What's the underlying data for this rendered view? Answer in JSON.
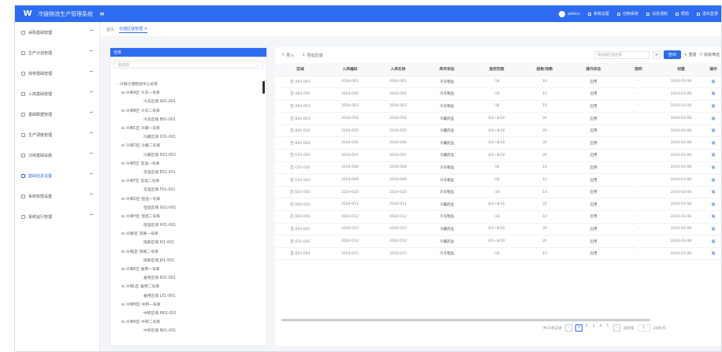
{
  "header": {
    "title": "冷链物流生产管理系统",
    "menu_icon": "menu-fold-icon",
    "user": "admin",
    "items": [
      "系统设置",
      "切换系统",
      "消息通知",
      "帮助",
      "退出登录"
    ]
  },
  "sidebar": {
    "items": [
      {
        "label": "采购基础管理",
        "active": false
      },
      {
        "label": "生产计划管理",
        "active": false
      },
      {
        "label": "库存基础管理",
        "active": false
      },
      {
        "label": "入库基础管理",
        "active": false
      },
      {
        "label": "基础数据管理",
        "active": false
      },
      {
        "label": "生产调度管理",
        "active": false
      },
      {
        "label": "冷库基础设施",
        "active": false
      },
      {
        "label": "基础信息设置",
        "active": true
      },
      {
        "label": "系统权限设置",
        "active": false
      },
      {
        "label": "系统运行管理",
        "active": false
      }
    ]
  },
  "breadcrumb": {
    "home": "首页",
    "tab": "仓储区域管理"
  },
  "tree": {
    "title": "仓库",
    "search_placeholder": "请选择",
    "nodes": [
      {
        "level": 0,
        "label": "– 冷链仓储配送中心总库"
      },
      {
        "level": 1,
        "label": "⊟ 冷库A区 冷冻一号库"
      },
      {
        "level": 2,
        "label": "冷冻区域 A01-001"
      },
      {
        "level": 1,
        "label": "⊟ 冷库B区 冷冻二号库"
      },
      {
        "level": 2,
        "label": "冷冻区域 B01-001"
      },
      {
        "level": 1,
        "label": "⊟ 冷库C区 冷藏一号库"
      },
      {
        "level": 2,
        "label": "冷藏区域 C01-001"
      },
      {
        "level": 1,
        "label": "⊟ 冷库D区 冷藏二号库"
      },
      {
        "level": 2,
        "label": "冷藏区域 D01-001"
      },
      {
        "level": 1,
        "label": "⊟ 冷库E区 常温一号库"
      },
      {
        "level": 2,
        "label": "常温区域 E01-001"
      },
      {
        "level": 1,
        "label": "⊟ 冷库F区 常温二号库"
      },
      {
        "level": 2,
        "label": "常温区域 F01-001"
      },
      {
        "level": 1,
        "label": "⊟ 冷库G区 恒温一号库"
      },
      {
        "level": 2,
        "label": "恒温区域 G01-001"
      },
      {
        "level": 1,
        "label": "⊟ 冷库H区 恒温二号库"
      },
      {
        "level": 2,
        "label": "恒温区域 H01-001"
      },
      {
        "level": 1,
        "label": "⊟ 冷库I区 隔离一号库"
      },
      {
        "level": 2,
        "label": "隔离区域 I01-001"
      },
      {
        "level": 1,
        "label": "⊟ 冷库J区 隔离二号库"
      },
      {
        "level": 2,
        "label": "隔离区域 J01-001"
      },
      {
        "level": 1,
        "label": "⊟ 冷库K区 备用一号库"
      },
      {
        "level": 2,
        "label": "备用区域 K01-001"
      },
      {
        "level": 1,
        "label": "⊟ 冷库L区 备用二号库"
      },
      {
        "level": 2,
        "label": "备用区域 L01-001"
      },
      {
        "level": 1,
        "label": "⊟ 冷库M区 中转一号库"
      },
      {
        "level": 2,
        "label": "中转区域 M01-001"
      },
      {
        "level": 1,
        "label": "⊟ 冷库N区 中转二号库"
      },
      {
        "level": 2,
        "label": "中转区域 N01-001"
      }
    ]
  },
  "toolbar": {
    "import": "导入",
    "export": "导出区域",
    "select_placeholder": "请选择区域名称",
    "clear": "×",
    "query": "查询",
    "reset": "重置",
    "more": "高级筛选"
  },
  "table": {
    "columns": [
      "区域",
      "入库编码",
      "入库名称",
      "库存状态",
      "温控范围",
      "层数/排数",
      "操作状态",
      "面积",
      "创建",
      "操作"
    ],
    "rows": [
      [
        "区-A01-001",
        "2024-001",
        "2024-001",
        "冷冻物品",
        "-18",
        "10",
        "启用",
        "-",
        "2024-03-08",
        "编"
      ],
      [
        "区-A01-002",
        "2024-002",
        "2024-002",
        "冷冻物品",
        "-18",
        "10",
        "启用",
        "-",
        "2024-03-08",
        "编"
      ],
      [
        "区-A01-003",
        "2024-003",
        "2024-003",
        "冷冻物品",
        "-18",
        "10",
        "启用",
        "-",
        "2024-03-08",
        "编"
      ],
      [
        "区-B01-001",
        "2024-004",
        "2024-004",
        "冷藏药品",
        "0/2~8/10",
        "20",
        "启用",
        "-",
        "2024-03-08",
        "编"
      ],
      [
        "区-B01-002",
        "2024-005",
        "2024-005",
        "冷藏药品",
        "0/2~8/10",
        "20",
        "启用",
        "-",
        "2024-03-08",
        "编"
      ],
      [
        "区-B01-003",
        "2024-006",
        "2024-006",
        "冷藏药品",
        "0/2~8/10",
        "20",
        "启用",
        "-",
        "2024-03-08",
        "编"
      ],
      [
        "区-C01-001",
        "2024-007",
        "2024-007",
        "冷藏药品",
        "0/2~8/10",
        "20",
        "启用",
        "-",
        "2024-03-08",
        "编"
      ],
      [
        "区-C01-002",
        "2024-008",
        "2024-008",
        "冷冻物品",
        "-18",
        "10",
        "启用",
        "-",
        "2024-03-08",
        "编"
      ],
      [
        "区-C01-003",
        "2024-009",
        "2024-009",
        "冷冻物品",
        "-18",
        "10",
        "启用",
        "-",
        "2024-03-08",
        "编"
      ],
      [
        "区-D01-001",
        "2024-010",
        "2024-010",
        "冷冻物品",
        "-18",
        "10",
        "启用",
        "-",
        "2024-03-08",
        "编"
      ],
      [
        "区-D01-002",
        "2024-011",
        "2024-011",
        "冷藏药品",
        "0/2~8/10",
        "20",
        "启用",
        "-",
        "2024-03-08",
        "编"
      ],
      [
        "区-D01-003",
        "2024-012",
        "2024-012",
        "冷冻物品",
        "-18",
        "10",
        "启用",
        "-",
        "2024-03-08",
        "编"
      ],
      [
        "区-E01-001",
        "2024-013",
        "2024-013",
        "冷藏药品",
        "0/2~8/10",
        "20",
        "启用",
        "-",
        "2024-03-08",
        "编"
      ],
      [
        "区-E01-002",
        "2024-014",
        "2024-014",
        "冷藏药品",
        "0/2~8/10",
        "20",
        "启用",
        "-",
        "2024-03-08",
        "编"
      ],
      [
        "区-E01-003",
        "2024-015",
        "2024-015",
        "冷冻物品",
        "-18",
        "10",
        "启用",
        "-",
        "2024-03-08",
        "编"
      ]
    ]
  },
  "pager": {
    "total": "共15条记录",
    "pages": [
      "1",
      "2",
      "3",
      "4",
      "5"
    ],
    "next": "›",
    "goto": "前往第",
    "page_input": "1",
    "page_size": "20条/页"
  },
  "colors": {
    "primary": "#2d6cf0",
    "sidebar_bg": "#ffffff",
    "page_bg": "#f3f5f9"
  }
}
